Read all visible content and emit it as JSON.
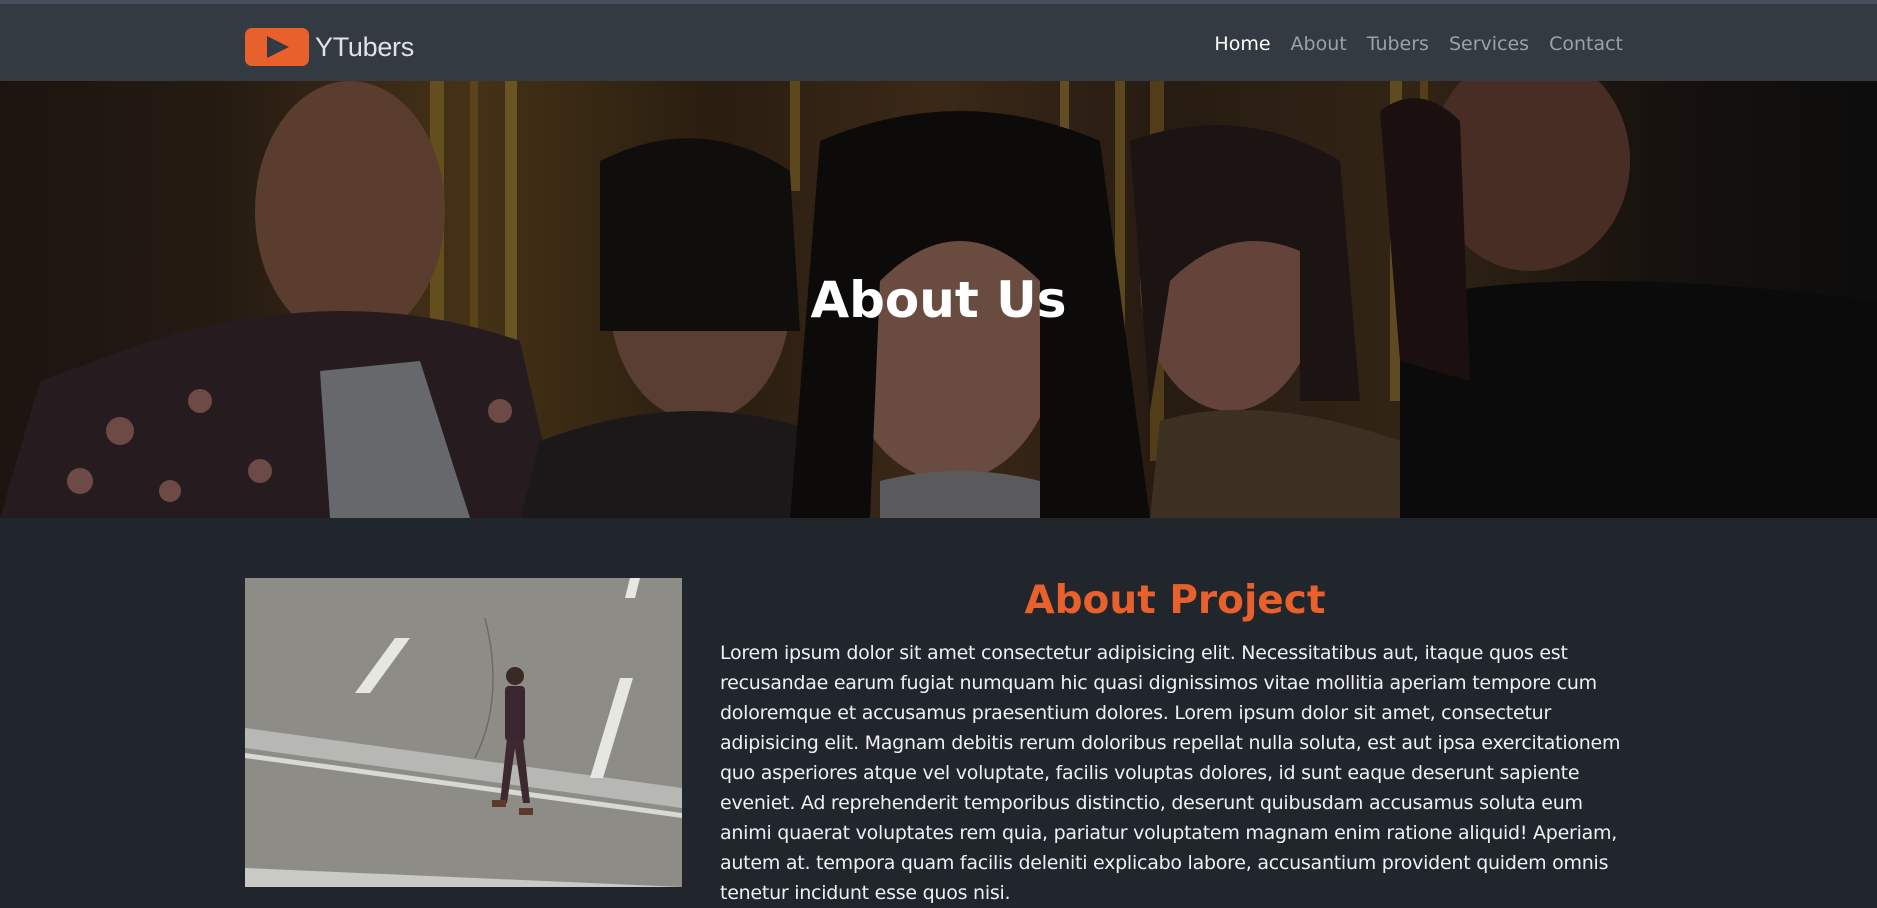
{
  "brand": {
    "name": "YTubers",
    "logo_icon": "play-icon",
    "logo_color": "#e8612d"
  },
  "nav": {
    "items": [
      {
        "label": "Home",
        "active": true
      },
      {
        "label": "About",
        "active": false
      },
      {
        "label": "Tubers",
        "active": false
      },
      {
        "label": "Services",
        "active": false
      },
      {
        "label": "Contact",
        "active": false
      }
    ]
  },
  "hero": {
    "title": "About Us"
  },
  "about": {
    "title": "About Project",
    "text": "Lorem ipsum dolor sit amet consectetur adipisicing elit. Necessitatibus aut, itaque quos est recusandae earum fugiat numquam hic quasi dignissimos vitae mollitia aperiam tempore cum doloremque et accusamus praesentium dolores. Lorem ipsum dolor sit amet, consectetur adipisicing elit. Magnam debitis rerum doloribus repellat nulla soluta, est aut ipsa exercitationem quo asperiores atque vel voluptate, facilis voluptas dolores, id sunt eaque deserunt sapiente eveniet. Ad reprehenderit temporibus distinctio, deserunt quibusdam accusamus soluta eum animi quaerat voluptates rem quia, pariatur voluptatem magnam enim ratione aliquid! Aperiam, autem at. tempora quam facilis deleniti explicabo labore, accusantium provident quidem omnis tenetur incidunt esse quos nisi."
  },
  "colors": {
    "accent": "#e8612d",
    "navbar": "#343a41",
    "background": "#21252c"
  }
}
